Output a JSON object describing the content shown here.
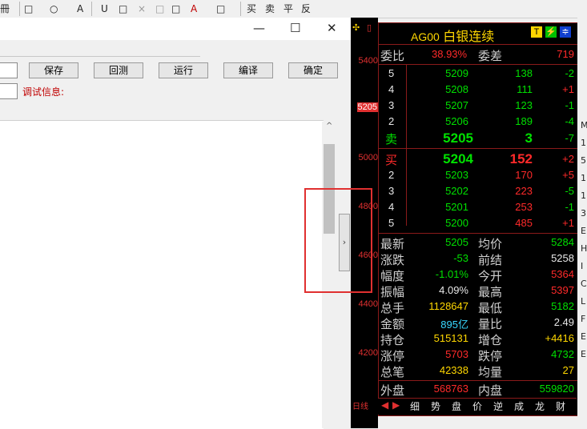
{
  "toolbar": {
    "items": [
      "冊",
      "□",
      "○",
      "A",
      "U",
      "□",
      "×",
      "□",
      "□",
      "A",
      "□",
      "买",
      "卖",
      "平",
      "反"
    ]
  },
  "editor": {
    "buttons": {
      "save": "保存",
      "backtest": "回测",
      "run": "运行",
      "compile": "编译",
      "confirm": "确定"
    },
    "debug_label": "调试信息:",
    "window_controls": {
      "minimize": "—",
      "maximize": "☐",
      "close": "✕"
    }
  },
  "chart": {
    "ylabels": [
      "5400",
      "5205",
      "5000",
      "4800",
      "4600",
      "4400",
      "4200"
    ],
    "current": "5205"
  },
  "quote": {
    "code": "AG00",
    "name": "白银连续",
    "icons": [
      "T",
      "⚡",
      "≑"
    ],
    "weibi_label": "委比",
    "weibi": "38.93%",
    "weicha_label": "委差",
    "weicha": "719",
    "asks": [
      {
        "lvl": "5",
        "price": "5209",
        "vol": "138",
        "chg": "-2"
      },
      {
        "lvl": "4",
        "price": "5208",
        "vol": "111",
        "chg": "+1"
      },
      {
        "lvl": "3",
        "price": "5207",
        "vol": "123",
        "chg": "-1"
      },
      {
        "lvl": "2",
        "price": "5206",
        "vol": "189",
        "chg": "-4"
      },
      {
        "lvl": "卖",
        "price": "5205",
        "vol": "3",
        "chg": "-7"
      }
    ],
    "bids": [
      {
        "lvl": "买",
        "price": "5204",
        "vol": "152",
        "chg": "+2"
      },
      {
        "lvl": "2",
        "price": "5203",
        "vol": "170",
        "chg": "+5"
      },
      {
        "lvl": "3",
        "price": "5202",
        "vol": "223",
        "chg": "-5"
      },
      {
        "lvl": "4",
        "price": "5201",
        "vol": "253",
        "chg": "-1"
      },
      {
        "lvl": "5",
        "price": "5200",
        "vol": "485",
        "chg": "+1"
      }
    ],
    "stats": [
      {
        "l1": "最新",
        "v1": "5205",
        "l2": "均价",
        "v2": "5284"
      },
      {
        "l1": "涨跌",
        "v1": "-53",
        "l2": "前结",
        "v2": "5258"
      },
      {
        "l1": "幅度",
        "v1": "-1.01%",
        "l2": "今开",
        "v2": "5364"
      },
      {
        "l1": "振幅",
        "v1": "4.09%",
        "l2": "最高",
        "v2": "5397"
      },
      {
        "l1": "总手",
        "v1": "1128647",
        "l2": "最低",
        "v2": "5182"
      },
      {
        "l1": "金额",
        "v1": "895亿",
        "l2": "量比",
        "v2": "2.49"
      },
      {
        "l1": "持仓",
        "v1": "515131",
        "l2": "增仓",
        "v2": "+4416"
      },
      {
        "l1": "涨停",
        "v1": "5703",
        "l2": "跌停",
        "v2": "4732"
      },
      {
        "l1": "总笔",
        "v1": "42338",
        "l2": "均量",
        "v2": "27"
      }
    ],
    "outer_label": "外盘",
    "outer": "568763",
    "inner_label": "内盘",
    "inner": "559820",
    "tabs": [
      "细",
      "势",
      "盘",
      "价",
      "逆",
      "成",
      "龙",
      "财"
    ]
  },
  "right_strip": [
    "M",
    "1",
    "5",
    "1",
    "1",
    "3",
    "E",
    "H",
    "I",
    "C",
    "L",
    "F",
    "E",
    "E"
  ]
}
